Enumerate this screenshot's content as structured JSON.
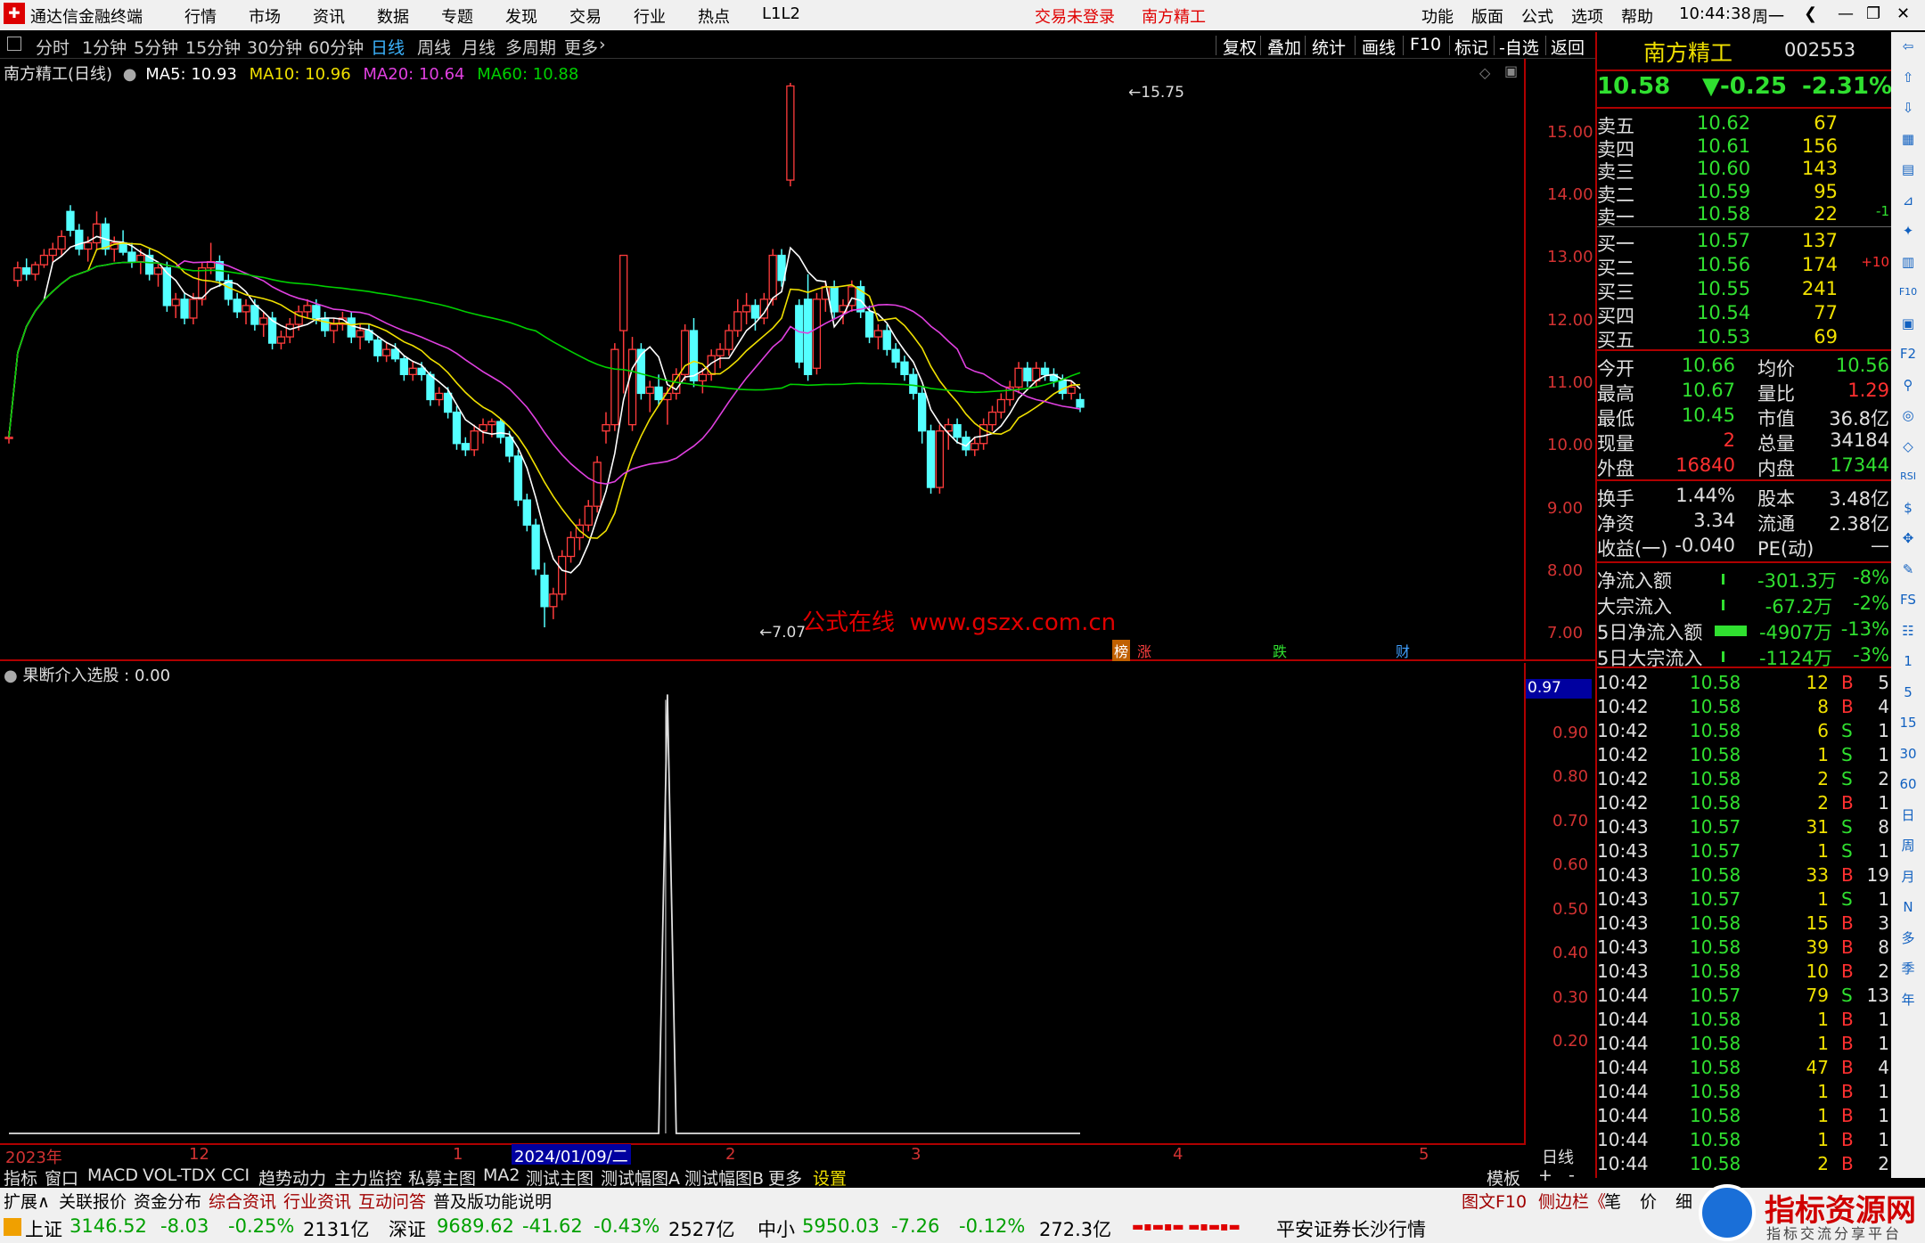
{
  "titlebar": {
    "app_title": "通达信金融终端",
    "menu": [
      "行情",
      "市场",
      "资讯",
      "数据",
      "专题",
      "发现",
      "交易",
      "行业",
      "热点",
      "L1L2"
    ],
    "login": "交易未登录",
    "stock_name": "南方精工",
    "right_menu": [
      "功能",
      "版面",
      "公式",
      "选项",
      "帮助"
    ],
    "time": "10:44:38",
    "weekday": "周一",
    "btn_back": "❮",
    "btn_min": "—",
    "btn_restore": "❐",
    "btn_close": "✕"
  },
  "periods": [
    "分时",
    "1分钟",
    "5分钟",
    "15分钟",
    "30分钟",
    "60分钟",
    "日线",
    "周线",
    "月线",
    "多周期",
    "更多"
  ],
  "selected_period": "日线",
  "chart_buttons": [
    "复权",
    "叠加",
    "统计",
    "画线",
    "F10",
    "标记",
    "-自选",
    "返回"
  ],
  "chart_header": {
    "title": "南方精工(日线)",
    "ma5": "MA5: 10.93",
    "ma10": "MA10: 10.96",
    "ma20": "MA20: 10.64",
    "ma60": "MA60: 10.88"
  },
  "main_axis": [
    "15.00",
    "14.00",
    "13.00",
    "12.00",
    "11.00",
    "10.00",
    "9.00",
    "8.00",
    "7.00"
  ],
  "annotations": {
    "high": "15.75",
    "low": "7.07",
    "watermark": "公式在线  www.gszx.com.cn"
  },
  "markers": [
    "榜",
    "涨",
    "跌",
    "财"
  ],
  "sub_header": "果断介入选股 : 0.00",
  "sub_axis": [
    "0.97",
    "0.90",
    "0.80",
    "0.70",
    "0.60",
    "0.50",
    "0.40",
    "0.30",
    "0.20"
  ],
  "date_axis": {
    "labels": [
      "2023年",
      "12",
      "1",
      "2024/01/09/二",
      "2",
      "3",
      "4",
      "5"
    ],
    "period": "日线"
  },
  "indicator_tabs": [
    "指标",
    "窗口",
    "MACD",
    "VOL-TDX",
    "CCI",
    "趋势动力",
    "主力监控",
    "私募主图",
    "MA2",
    "测试主图",
    "测试幅图A",
    "测试幅图B",
    "更多",
    "设置"
  ],
  "template_btns": [
    "模板",
    "+",
    "-"
  ],
  "bottom_tabs": [
    "扩展∧",
    "关联报价",
    "资金分布",
    "综合资讯",
    "行业资讯",
    "互动问答",
    "普及版功能说明"
  ],
  "bottom_right": [
    "图文F10",
    "侧边栏《",
    "笔",
    "价",
    "细"
  ],
  "quote": {
    "name": "南方精工",
    "code": "002553",
    "price": "10.58",
    "change": "▼-0.25",
    "pct": "-2.31%"
  },
  "asks": [
    [
      "卖五",
      "10.62",
      "67",
      ""
    ],
    [
      "卖四",
      "10.61",
      "156",
      ""
    ],
    [
      "卖三",
      "10.60",
      "143",
      ""
    ],
    [
      "卖二",
      "10.59",
      "95",
      ""
    ],
    [
      "卖一",
      "10.58",
      "22",
      "-1"
    ]
  ],
  "bids": [
    [
      "买一",
      "10.57",
      "137",
      ""
    ],
    [
      "买二",
      "10.56",
      "174",
      "+10"
    ],
    [
      "买三",
      "10.55",
      "241",
      ""
    ],
    [
      "买四",
      "10.54",
      "77",
      ""
    ],
    [
      "买五",
      "10.53",
      "69",
      ""
    ]
  ],
  "stats": [
    [
      "今开",
      "10.66",
      "均价",
      "10.56"
    ],
    [
      "最高",
      "10.67",
      "量比",
      "1.29"
    ],
    [
      "最低",
      "10.45",
      "市值",
      "36.8亿"
    ],
    [
      "现量",
      "2",
      "总量",
      "34184"
    ],
    [
      "外盘",
      "16840",
      "内盘",
      "17344"
    ]
  ],
  "stats2": [
    [
      "换手",
      "1.44%",
      "股本",
      "3.48亿"
    ],
    [
      "净资",
      "3.34",
      "流通",
      "2.38亿"
    ],
    [
      "收益(一)",
      "-0.040",
      "PE(动)",
      "—"
    ]
  ],
  "flows": [
    [
      "净流入额",
      "-301.3万",
      "-8%"
    ],
    [
      "大宗流入",
      "-67.2万",
      "-2%"
    ],
    [
      "5日净流入额",
      "-4907万",
      "-13%"
    ],
    [
      "5日大宗流入",
      "-1124万",
      "-3%"
    ]
  ],
  "ticks": [
    [
      "10:42",
      "10.58",
      "12",
      "B",
      "5"
    ],
    [
      "10:42",
      "10.58",
      "8",
      "B",
      "4"
    ],
    [
      "10:42",
      "10.58",
      "6",
      "S",
      "1"
    ],
    [
      "10:42",
      "10.58",
      "1",
      "S",
      "1"
    ],
    [
      "10:42",
      "10.58",
      "2",
      "S",
      "2"
    ],
    [
      "10:42",
      "10.58",
      "2",
      "B",
      "1"
    ],
    [
      "10:43",
      "10.57",
      "31",
      "S",
      "8"
    ],
    [
      "10:43",
      "10.57",
      "1",
      "S",
      "1"
    ],
    [
      "10:43",
      "10.58",
      "33",
      "B",
      "19"
    ],
    [
      "10:43",
      "10.57",
      "1",
      "S",
      "1"
    ],
    [
      "10:43",
      "10.58",
      "15",
      "B",
      "3"
    ],
    [
      "10:43",
      "10.58",
      "39",
      "B",
      "8"
    ],
    [
      "10:43",
      "10.58",
      "10",
      "B",
      "2"
    ],
    [
      "10:44",
      "10.57",
      "79",
      "S",
      "13"
    ],
    [
      "10:44",
      "10.58",
      "1",
      "B",
      "1"
    ],
    [
      "10:44",
      "10.58",
      "1",
      "B",
      "1"
    ],
    [
      "10:44",
      "10.58",
      "47",
      "B",
      "4"
    ],
    [
      "10:44",
      "10.58",
      "1",
      "B",
      "1"
    ],
    [
      "10:44",
      "10.58",
      "1",
      "B",
      "1"
    ],
    [
      "10:44",
      "10.58",
      "1",
      "B",
      "1"
    ],
    [
      "10:44",
      "10.58",
      "2",
      "B",
      "2"
    ]
  ],
  "far_tools": [
    "⇦",
    "⇧",
    "⇩",
    "▦",
    "▤",
    "⊿",
    "✦",
    "▥",
    "F10",
    "▣",
    "F2",
    "⚲",
    "◎",
    "◇",
    "RSI",
    "$",
    "✥",
    "✎",
    "FS",
    "☷",
    "1",
    "5",
    "15",
    "30",
    "60",
    "日",
    "周",
    "月",
    "N",
    "多",
    "季",
    "年"
  ],
  "status": {
    "sh_name": "上证",
    "sh": "3146.52",
    "sh_chg": "-8.03",
    "sh_pct": "-0.25%",
    "sh_amt": "2131亿",
    "sz_name": "深证",
    "sz": "9689.62",
    "sz_chg": "-41.62",
    "sz_pct": "-0.43%",
    "sz_amt": "2527亿",
    "zx_name": "中小",
    "zx": "5950.03",
    "zx_chg": "-7.26",
    "zx_pct": "-0.12%",
    "zx_amt": "272.3亿",
    "broker": "平安证券长沙行情",
    "logo_title": "指标资源网",
    "logo_sub": "指标交流分享平台"
  },
  "chart_data": {
    "type": "candlestick",
    "series_main": [
      [
        10.1,
        10.2,
        10.0,
        10.1
      ],
      [
        12.6,
        12.9,
        12.5,
        12.8
      ],
      [
        12.8,
        12.95,
        12.6,
        12.7
      ],
      [
        12.7,
        12.9,
        12.6,
        12.85
      ],
      [
        12.85,
        13.1,
        12.8,
        13.0
      ],
      [
        13.0,
        13.2,
        12.9,
        13.1
      ],
      [
        13.1,
        13.4,
        13.0,
        13.3
      ],
      [
        13.7,
        13.8,
        13.3,
        13.4
      ],
      [
        13.4,
        13.5,
        13.0,
        13.1
      ],
      [
        13.1,
        13.3,
        12.9,
        13.2
      ],
      [
        13.2,
        13.7,
        13.1,
        13.5
      ],
      [
        13.5,
        13.6,
        13.0,
        13.1
      ],
      [
        13.1,
        13.3,
        12.9,
        13.2
      ],
      [
        13.2,
        13.4,
        13.0,
        13.05
      ],
      [
        13.05,
        13.2,
        12.8,
        12.9
      ],
      [
        12.9,
        13.1,
        12.7,
        13.0
      ],
      [
        13.0,
        13.1,
        12.6,
        12.7
      ],
      [
        12.7,
        12.9,
        12.5,
        12.8
      ],
      [
        12.8,
        12.9,
        12.1,
        12.2
      ],
      [
        12.2,
        12.4,
        12.0,
        12.3
      ],
      [
        12.3,
        12.4,
        11.9,
        12.0
      ],
      [
        12.0,
        12.4,
        11.9,
        12.3
      ],
      [
        12.3,
        12.9,
        12.2,
        12.8
      ],
      [
        12.8,
        13.2,
        12.7,
        12.9
      ],
      [
        12.9,
        13.0,
        12.5,
        12.6
      ],
      [
        12.6,
        12.7,
        12.2,
        12.3
      ],
      [
        12.3,
        12.4,
        12.0,
        12.1
      ],
      [
        12.1,
        12.3,
        11.9,
        12.2
      ],
      [
        12.2,
        12.3,
        11.8,
        11.9
      ],
      [
        11.9,
        12.1,
        11.7,
        12.0
      ],
      [
        12.0,
        12.1,
        11.5,
        11.6
      ],
      [
        11.6,
        11.8,
        11.5,
        11.7
      ],
      [
        11.7,
        12.0,
        11.6,
        11.9
      ],
      [
        11.9,
        12.2,
        11.8,
        12.1
      ],
      [
        12.1,
        12.3,
        12.0,
        12.2
      ],
      [
        12.2,
        12.3,
        11.9,
        12.0
      ],
      [
        12.0,
        12.1,
        11.7,
        11.8
      ],
      [
        11.8,
        12.0,
        11.6,
        11.9
      ],
      [
        11.9,
        12.1,
        11.8,
        12.0
      ],
      [
        12.0,
        12.1,
        11.6,
        11.7
      ],
      [
        11.7,
        11.9,
        11.5,
        11.8
      ],
      [
        11.8,
        11.9,
        11.6,
        11.65
      ],
      [
        11.65,
        11.7,
        11.3,
        11.4
      ],
      [
        11.4,
        11.6,
        11.3,
        11.5
      ],
      [
        11.5,
        11.6,
        11.3,
        11.35
      ],
      [
        11.35,
        11.4,
        11.0,
        11.1
      ],
      [
        11.1,
        11.3,
        11.0,
        11.2
      ],
      [
        11.2,
        11.3,
        11.0,
        11.1
      ],
      [
        11.1,
        11.15,
        10.6,
        10.7
      ],
      [
        10.7,
        10.9,
        10.6,
        10.8
      ],
      [
        10.8,
        10.9,
        10.4,
        10.5
      ],
      [
        10.5,
        10.6,
        9.9,
        10.0
      ],
      [
        10.0,
        10.1,
        9.8,
        9.9
      ],
      [
        9.9,
        10.3,
        9.8,
        10.2
      ],
      [
        10.2,
        10.4,
        10.0,
        10.3
      ],
      [
        10.3,
        10.4,
        10.1,
        10.35
      ],
      [
        10.35,
        10.4,
        10.0,
        10.1
      ],
      [
        10.1,
        10.2,
        9.7,
        9.8
      ],
      [
        9.8,
        9.9,
        9.0,
        9.1
      ],
      [
        9.1,
        9.2,
        8.6,
        8.7
      ],
      [
        8.7,
        8.8,
        7.9,
        8.0
      ],
      [
        7.9,
        8.1,
        7.07,
        7.4
      ],
      [
        7.4,
        7.7,
        7.2,
        7.6
      ],
      [
        7.6,
        8.3,
        7.5,
        8.2
      ],
      [
        8.2,
        8.6,
        8.1,
        8.5
      ],
      [
        8.5,
        8.8,
        8.3,
        8.7
      ],
      [
        8.7,
        9.1,
        8.6,
        9.0
      ],
      [
        9.0,
        9.8,
        8.9,
        9.7
      ],
      [
        10.2,
        10.5,
        10.0,
        10.3
      ],
      [
        10.3,
        11.6,
        10.2,
        11.5
      ],
      [
        11.8,
        13.0,
        10.8,
        13.0
      ],
      [
        10.3,
        11.7,
        10.2,
        11.5
      ],
      [
        11.5,
        11.6,
        10.7,
        10.8
      ],
      [
        10.8,
        11.0,
        10.5,
        10.9
      ],
      [
        10.9,
        11.1,
        10.6,
        10.7
      ],
      [
        10.7,
        10.9,
        10.3,
        10.8
      ],
      [
        10.8,
        11.2,
        10.7,
        11.1
      ],
      [
        11.1,
        11.9,
        11.0,
        11.8
      ],
      [
        11.8,
        12.0,
        10.9,
        11.0
      ],
      [
        11.0,
        11.2,
        10.8,
        11.1
      ],
      [
        11.1,
        11.5,
        11.0,
        11.4
      ],
      [
        11.4,
        11.6,
        11.2,
        11.5
      ],
      [
        11.5,
        11.9,
        11.4,
        11.8
      ],
      [
        11.8,
        12.3,
        11.7,
        12.1
      ],
      [
        12.1,
        12.4,
        11.9,
        12.2
      ],
      [
        12.2,
        12.3,
        11.8,
        12.0
      ],
      [
        12.0,
        12.4,
        11.9,
        12.3
      ],
      [
        12.3,
        13.1,
        12.2,
        13.0
      ],
      [
        13.0,
        13.1,
        12.5,
        12.6
      ],
      [
        14.2,
        15.75,
        14.1,
        15.7
      ],
      [
        12.2,
        12.3,
        11.2,
        11.3
      ],
      [
        12.3,
        12.7,
        11.0,
        11.1
      ],
      [
        11.2,
        12.4,
        11.1,
        12.3
      ],
      [
        12.3,
        12.6,
        12.1,
        12.5
      ],
      [
        12.5,
        12.6,
        12.0,
        12.1
      ],
      [
        12.1,
        12.3,
        11.9,
        12.2
      ],
      [
        12.2,
        12.6,
        12.1,
        12.5
      ],
      [
        12.5,
        12.6,
        12.0,
        12.1
      ],
      [
        12.1,
        12.2,
        11.6,
        11.7
      ],
      [
        11.7,
        11.9,
        11.5,
        11.8
      ],
      [
        11.8,
        11.9,
        11.4,
        11.5
      ],
      [
        11.5,
        11.6,
        11.2,
        11.3
      ],
      [
        11.3,
        11.4,
        11.0,
        11.1
      ],
      [
        11.1,
        11.2,
        10.7,
        10.8
      ],
      [
        10.8,
        10.9,
        10.0,
        10.2
      ],
      [
        10.2,
        10.3,
        9.2,
        9.3
      ],
      [
        9.3,
        10.3,
        9.2,
        10.2
      ],
      [
        10.2,
        10.4,
        9.9,
        10.3
      ],
      [
        10.3,
        10.4,
        10.0,
        10.1
      ],
      [
        10.1,
        10.2,
        9.8,
        9.9
      ],
      [
        9.9,
        10.1,
        9.8,
        10.0
      ],
      [
        10.0,
        10.4,
        9.9,
        10.3
      ],
      [
        10.3,
        10.6,
        10.2,
        10.5
      ],
      [
        10.5,
        10.8,
        10.4,
        10.7
      ],
      [
        10.7,
        11.0,
        10.6,
        10.9
      ],
      [
        10.9,
        11.3,
        10.8,
        11.2
      ],
      [
        11.2,
        11.3,
        10.9,
        11.0
      ],
      [
        11.0,
        11.3,
        10.9,
        11.2
      ],
      [
        11.2,
        11.3,
        11.0,
        11.1
      ],
      [
        11.1,
        11.2,
        10.9,
        11.0
      ],
      [
        11.0,
        11.1,
        10.7,
        10.8
      ],
      [
        10.8,
        11.0,
        10.7,
        10.9
      ],
      [
        10.7,
        10.8,
        10.5,
        10.58
      ]
    ],
    "ylim": [
      6.9,
      15.9
    ],
    "signal": {
      "index": 75,
      "peak": 0.97,
      "ylim": [
        0,
        1.02
      ]
    }
  }
}
